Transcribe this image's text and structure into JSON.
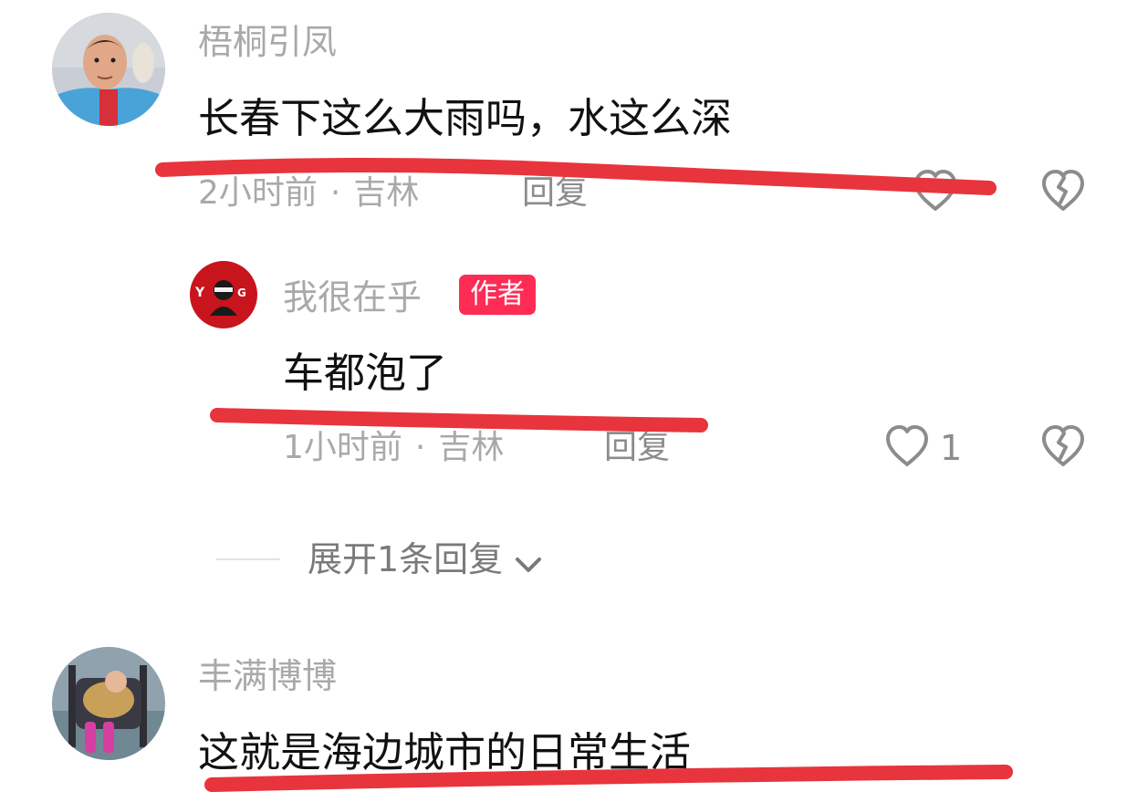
{
  "colors": {
    "username": "#a9a9a9",
    "comment_text": "#111111",
    "meta": "#a9a9a9",
    "author_badge_bg": "#fe2c55",
    "annotation_underline": "#e8343d"
  },
  "comments": [
    {
      "username": "梧桐引凤",
      "text": "长春下这么大雨吗，水这么深",
      "time": "2小时前",
      "location": "吉林",
      "reply_label": "回复",
      "like_count": "",
      "like_icon": "heart-outline-icon",
      "dislike_icon": "broken-heart-icon"
    },
    {
      "username": "我很在乎",
      "badge": "作者",
      "text": "车都泡了",
      "time": "1小时前",
      "location": "吉林",
      "reply_label": "回复",
      "like_count": "1",
      "like_icon": "heart-outline-icon",
      "dislike_icon": "broken-heart-icon"
    },
    {
      "username": "丰满博博",
      "text": "这就是海边城市的日常生活"
    }
  ],
  "expand_replies": {
    "label": "展开1条回复",
    "icon": "chevron-down-icon"
  }
}
